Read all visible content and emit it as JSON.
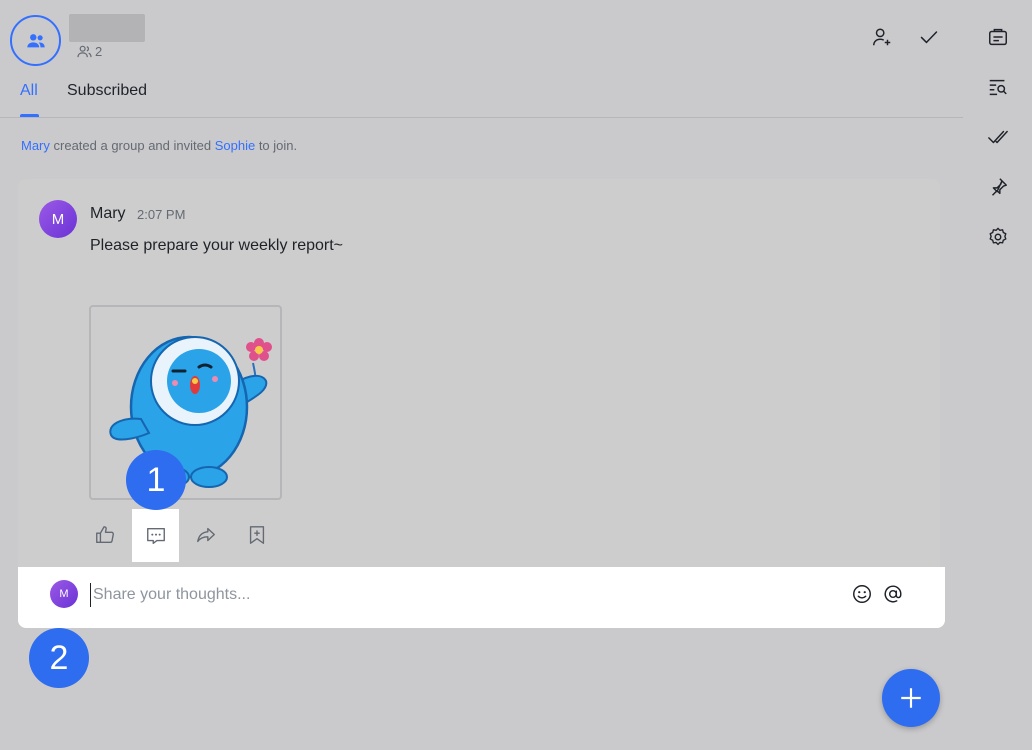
{
  "header": {
    "member_count": "2"
  },
  "tabs": [
    {
      "label": "All",
      "active": true
    },
    {
      "label": "Subscribed",
      "active": false
    }
  ],
  "system_message": {
    "actor": "Mary",
    "text_mid": "created a group and invited",
    "target": "Sophie",
    "text_end": "to join."
  },
  "message": {
    "avatar_initial": "M",
    "sender": "Mary",
    "time": "2:07 PM",
    "text": "Please prepare your weekly report~"
  },
  "badges": {
    "first": "1",
    "second": "2"
  },
  "comment": {
    "avatar_initial": "M",
    "placeholder": "Share your thoughts..."
  },
  "icons": {
    "header": [
      "group-icon",
      "add-member-icon",
      "check-icon"
    ],
    "rail": [
      "board-icon",
      "search-list-icon",
      "done-icon",
      "pin-icon",
      "settings-icon"
    ],
    "actions": [
      "like-icon",
      "comment-icon",
      "share-icon",
      "bookmark-icon"
    ],
    "input": [
      "emoji-icon",
      "mention-icon"
    ]
  },
  "colors": {
    "accent": "#3370ff",
    "badge": "#2e6cf0",
    "overlay": "#cacacc"
  }
}
